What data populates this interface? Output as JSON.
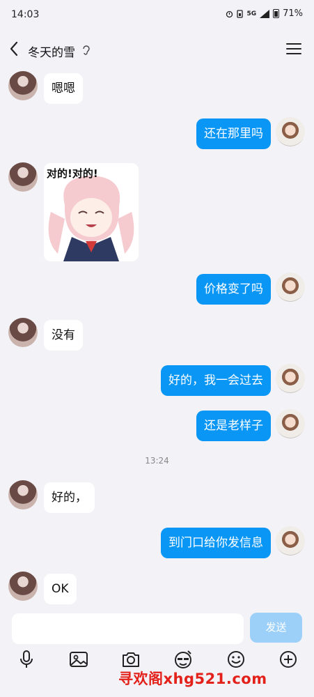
{
  "status_bar": {
    "time": "14:03",
    "network": "5G",
    "battery": "71%"
  },
  "header": {
    "title": "冬天的雪"
  },
  "messages": [
    {
      "side": "left",
      "text": "嗯嗯"
    },
    {
      "side": "right",
      "text": "还在那里吗"
    },
    {
      "side": "left",
      "sticker": "anime-sticker",
      "sticker_text": "对的!对的!"
    },
    {
      "side": "right",
      "text": "价格变了吗"
    },
    {
      "side": "left",
      "text": "没有"
    },
    {
      "side": "right",
      "text": "好的，我一会过去"
    },
    {
      "side": "right",
      "text": "还是老样子"
    },
    {
      "timestamp": "13:24"
    },
    {
      "side": "left",
      "text": "好的，"
    },
    {
      "side": "right",
      "text": "到门口给你发信息"
    },
    {
      "side": "left",
      "text": "OK"
    }
  ],
  "composer": {
    "send_label": "发送",
    "placeholder": ""
  },
  "toolbar_icons": [
    "microphone-icon",
    "image-icon",
    "camera-icon",
    "sticker-icon",
    "emoji-icon",
    "add-icon"
  ],
  "watermark": "寻欢阁xhg521.com",
  "colors": {
    "accent": "#0a96f5",
    "send_disabled": "#9dd0f8",
    "background": "#f2f2f7",
    "watermark": "#e3211a"
  }
}
